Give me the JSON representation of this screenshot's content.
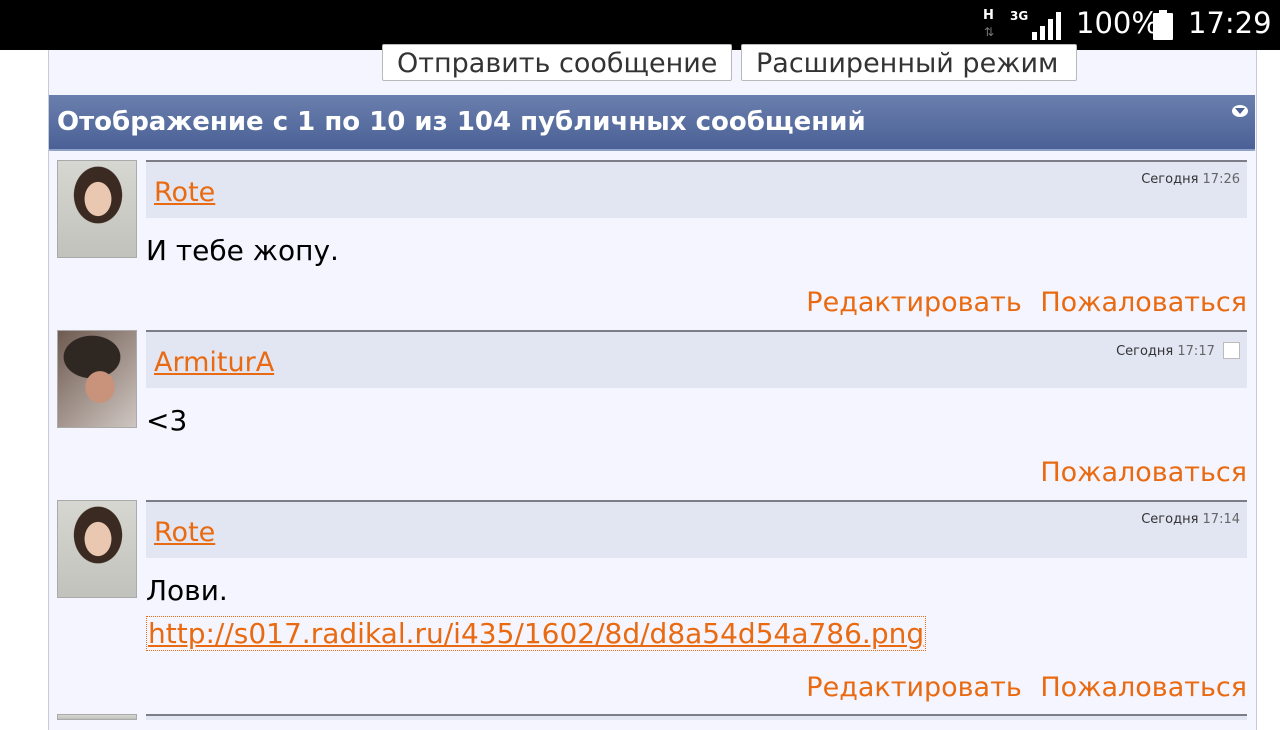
{
  "status_bar": {
    "network_type": "H",
    "network_gen": "3G",
    "battery": "100%",
    "time": "17:29"
  },
  "actions": {
    "send": "Отправить сообщение",
    "advanced": "Расширенный режим"
  },
  "header": {
    "title": "Отображение с 1 по 10 из 104 публичных сообщений"
  },
  "messages": [
    {
      "user": "Rote",
      "date": "Сегодня",
      "time": "17:26",
      "text": "И тебе жопу.",
      "edit": "Редактировать",
      "report": "Пожаловаться"
    },
    {
      "user": "ArmiturA",
      "date": "Сегодня",
      "time": "17:17",
      "text": "<3",
      "report": "Пожаловаться"
    },
    {
      "user": "Rote",
      "date": "Сегодня",
      "time": "17:14",
      "text": "Лови.",
      "link": "http://s017.radikal.ru/i435/1602/8d/d8a54d54a786.png",
      "edit": "Редактировать",
      "report": "Пожаловаться"
    }
  ],
  "colors": {
    "header_bg": "#5a6fa3",
    "link": "#e96a10",
    "page_bg": "#f5f5ff",
    "post_bar": "#e2e6f3"
  }
}
